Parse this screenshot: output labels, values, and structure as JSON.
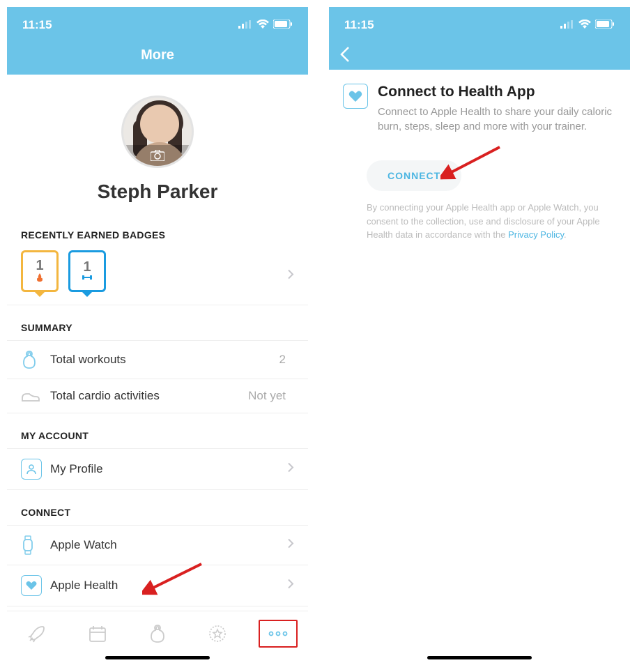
{
  "status": {
    "time": "11:15"
  },
  "screen1": {
    "header_title": "More",
    "profile_name": "Steph Parker",
    "sections": {
      "badges_label": "RECENTLY EARNED BADGES",
      "summary_label": "SUMMARY",
      "account_label": "MY ACCOUNT",
      "connect_label": "CONNECT"
    },
    "badges": [
      {
        "number": "1",
        "sub_icon": "flame"
      },
      {
        "number": "1",
        "sub_icon": "dumbbell"
      }
    ],
    "summary": {
      "workouts_label": "Total workouts",
      "workouts_value": "2",
      "cardio_label": "Total cardio activities",
      "cardio_value": "Not yet"
    },
    "account": {
      "profile_label": "My Profile"
    },
    "connect": {
      "watch_label": "Apple Watch",
      "health_label": "Apple Health"
    }
  },
  "screen2": {
    "title": "Connect to Health App",
    "description": "Connect to Apple Health to share your daily caloric burn, steps, sleep and more with your trainer.",
    "button_label": "CONNECT",
    "disclaimer_prefix": "By connecting your Apple Health app or Apple Watch, you consent to the collection, use and disclosure of your Apple Health data in accordance with the ",
    "privacy_link": "Privacy Policy",
    "disclaimer_suffix": "."
  },
  "colors": {
    "primary": "#6BC4E8",
    "arrow": "#D92020"
  }
}
